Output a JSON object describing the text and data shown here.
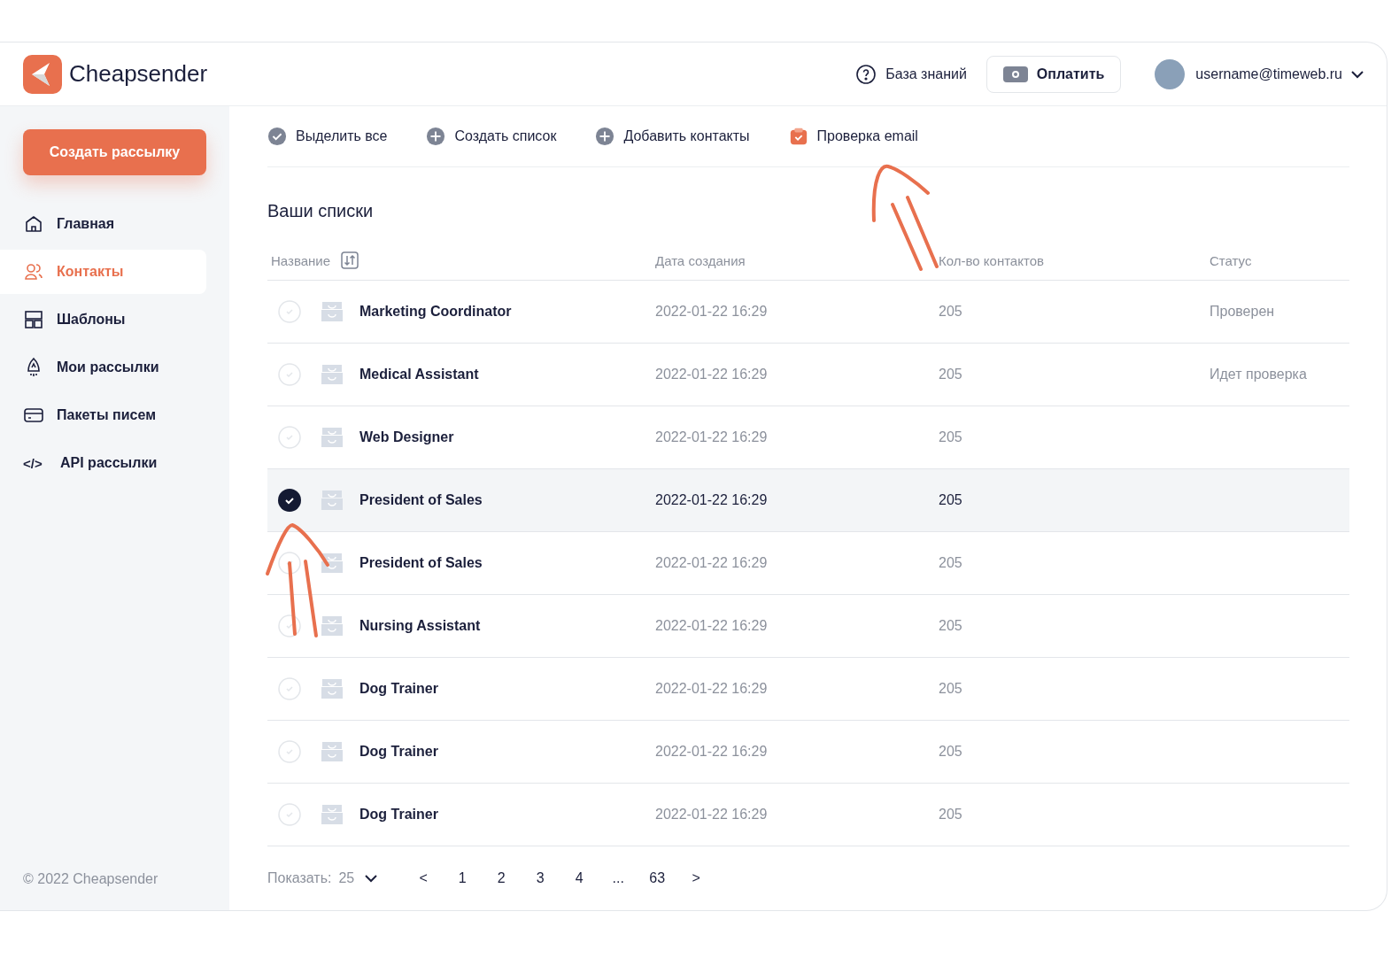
{
  "header": {
    "brand": "Cheapsender",
    "help_link": "База знаний",
    "pay_button": "Оплатить",
    "user": "username@timeweb.ru"
  },
  "sidebar": {
    "create_button": "Создать рассылку",
    "items": [
      {
        "kind": "home",
        "label": "Главная",
        "selected": false
      },
      {
        "kind": "contacts",
        "label": "Контакты",
        "selected": true
      },
      {
        "kind": "templates",
        "label": "Шаблоны",
        "selected": false
      },
      {
        "kind": "mailings",
        "label": "Мои рассылки",
        "selected": false
      },
      {
        "kind": "packages",
        "label": "Пакеты писем",
        "selected": false
      },
      {
        "kind": "api",
        "icon_text": "</>",
        "label": "API рассылки",
        "selected": false
      }
    ],
    "copyright": "© 2022 Cheapsender"
  },
  "toolbar": [
    {
      "kind": "check",
      "label": "Выделить все"
    },
    {
      "kind": "plus",
      "label": "Создать список"
    },
    {
      "kind": "plus",
      "label": "Добавить контакты"
    },
    {
      "kind": "verify",
      "label": "Проверка email"
    }
  ],
  "section_title": "Ваши списки",
  "table": {
    "columns": [
      "Название",
      "Дата создания",
      "Кол-во контактов",
      "Статус"
    ],
    "rows": [
      {
        "name": "Marketing Coordinator",
        "date": "2022-01-22  16:29",
        "count": "205",
        "status": "Проверен",
        "checked": false
      },
      {
        "name": "Medical Assistant",
        "date": "2022-01-22  16:29",
        "count": "205",
        "status": "Идет проверка",
        "checked": false
      },
      {
        "name": "Web Designer",
        "date": "2022-01-22  16:29",
        "count": "205",
        "checked": false
      },
      {
        "name": "President of Sales",
        "date": "2022-01-22  16:29",
        "count": "205",
        "checked": true
      },
      {
        "name": "President of Sales",
        "date": "2022-01-22  16:29",
        "count": "205",
        "checked": false
      },
      {
        "name": "Nursing Assistant",
        "date": "2022-01-22  16:29",
        "count": "205",
        "checked": false
      },
      {
        "name": "Dog Trainer",
        "date": "2022-01-22  16:29",
        "count": "205",
        "checked": false
      },
      {
        "name": "Dog Trainer",
        "date": "2022-01-22  16:29",
        "count": "205",
        "checked": false
      },
      {
        "name": "Dog Trainer",
        "date": "2022-01-22  16:29",
        "count": "205",
        "checked": false
      }
    ]
  },
  "pagination": {
    "show_label": "Показать:",
    "page_size": "25",
    "prev": "<",
    "pages": [
      "1",
      "2",
      "3",
      "4",
      "...",
      "63"
    ],
    "next": ">"
  }
}
